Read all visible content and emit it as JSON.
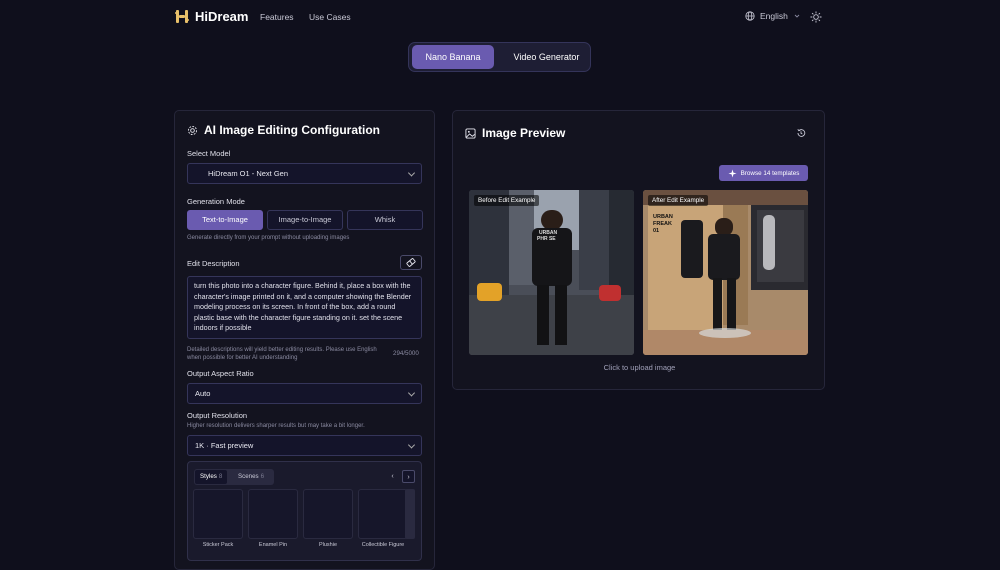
{
  "nav": {
    "brand": "HiDream",
    "links": [
      "Features",
      "Use Cases"
    ],
    "language": "English"
  },
  "mode_switch": {
    "active": "Nano Banana",
    "other": "Video Generator"
  },
  "config": {
    "title": "AI Image Editing Configuration",
    "model_label": "Select Model",
    "model_value": "HiDream O1 - Next Gen",
    "gen_mode_label": "Generation Mode",
    "modes": [
      "Text-to-Image",
      "Image-to-Image",
      "Whisk"
    ],
    "active_mode": "Text-to-Image",
    "mode_hint": "Generate directly from your prompt without uploading images",
    "edit_label": "Edit Description",
    "edit_text": "turn this photo into a character figure. Behind it, place a box with the character's image printed on it, and a computer showing the Blender modeling process on its screen. In front of the box, add a round plastic base with the character figure standing on it. set the scene indoors if possible",
    "edit_hint": "Detailed descriptions will yield better editing results. Please use English when possible for better AI understanding",
    "char_count": "294/5000",
    "aspect_label": "Output Aspect Ratio",
    "aspect_value": "Auto",
    "resolution_label": "Output Resolution",
    "resolution_hint": "Higher resolution delivers sharper results but may take a bit longer.",
    "resolution_value": "1K · Fast preview",
    "gallery": {
      "tabs": [
        {
          "label": "Styles",
          "count": "8"
        },
        {
          "label": "Scenes",
          "count": "6"
        }
      ],
      "items": [
        "Sticker Pack",
        "Enamel Pin",
        "Plushie",
        "Collectible Figure"
      ]
    }
  },
  "preview": {
    "title": "Image Preview",
    "browse_label": "Browse 14 templates",
    "before_label": "Before Edit Example",
    "after_label": "After Edit Example",
    "upload_hint": "Click to upload image",
    "shirt_text": [
      "URBAN",
      "PHR SE"
    ],
    "box_text": [
      "URBAN",
      "FREAK",
      "01"
    ]
  },
  "colors": {
    "accent": "#6a5bb0",
    "background": "#0f0f1c",
    "panel": "#13131f",
    "logo": "#e8c06a"
  }
}
